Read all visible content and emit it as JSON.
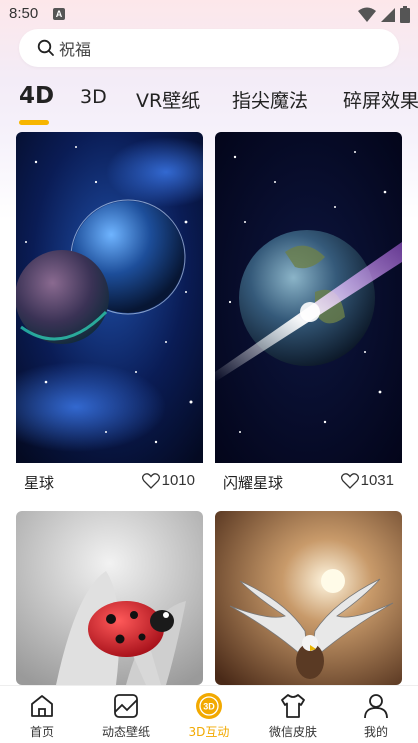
{
  "status_bar": {
    "time": "8:50",
    "notification_icon_letter": "A",
    "icons": [
      "wifi-icon",
      "signal-icon",
      "battery-icon"
    ]
  },
  "search": {
    "placeholder": "祝福",
    "icon": "search-icon"
  },
  "tabs": [
    {
      "label": "4D",
      "active": true
    },
    {
      "label": "3D",
      "active": false
    },
    {
      "label": "VR壁纸",
      "active": false
    },
    {
      "label": "指尖魔法",
      "active": false
    },
    {
      "label": "碎屏效果",
      "active": false
    }
  ],
  "accent_color": "#f7b500",
  "cards": [
    {
      "title": "星球",
      "likes": "1010",
      "image": "blue planets in starry space"
    },
    {
      "title": "闪耀星球",
      "likes": "1031",
      "image": "earth with light flare in space"
    },
    {
      "title": "",
      "likes": "",
      "image": "red ladybug on white flower"
    },
    {
      "title": "",
      "likes": "",
      "image": "eagle with spread wings under sun"
    }
  ],
  "bottom_nav": [
    {
      "label": "首页",
      "icon": "home-icon",
      "active": false
    },
    {
      "label": "动态壁纸",
      "icon": "wallpaper-icon",
      "active": false
    },
    {
      "label": "3D互动",
      "icon": "3d-icon",
      "active": true
    },
    {
      "label": "微信皮肤",
      "icon": "tshirt-icon",
      "active": false
    },
    {
      "label": "我的",
      "icon": "profile-icon",
      "active": false
    }
  ]
}
